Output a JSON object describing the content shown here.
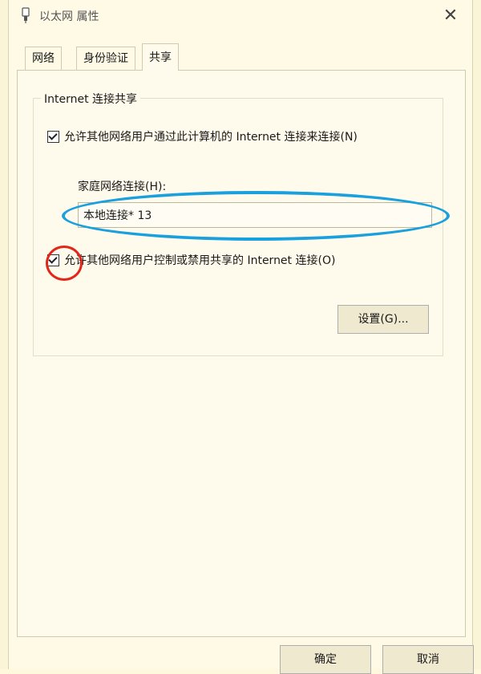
{
  "window": {
    "title": "以太网 属性",
    "close_glyph": "✕"
  },
  "tabs": [
    {
      "label": "网络"
    },
    {
      "label": "身份验证"
    },
    {
      "label": "共享"
    }
  ],
  "sharing": {
    "group_title": "Internet 连接共享",
    "allow_connect_label": "允许其他网络用户通过此计算机的 Internet 连接来连接(N)",
    "allow_connect_checked": true,
    "home_network_label": "家庭网络连接(H):",
    "home_network_value": "本地连接* 13",
    "allow_control_label": "允许其他网络用户控制或禁用共享的 Internet 连接(O)",
    "allow_control_checked": true,
    "settings_button": "设置(G)..."
  },
  "footer": {
    "ok_button": "确定",
    "cancel_button": "取消"
  },
  "colors": {
    "annotation_ellipse": "#1aa0dc",
    "annotation_circle": "#e0281a"
  }
}
